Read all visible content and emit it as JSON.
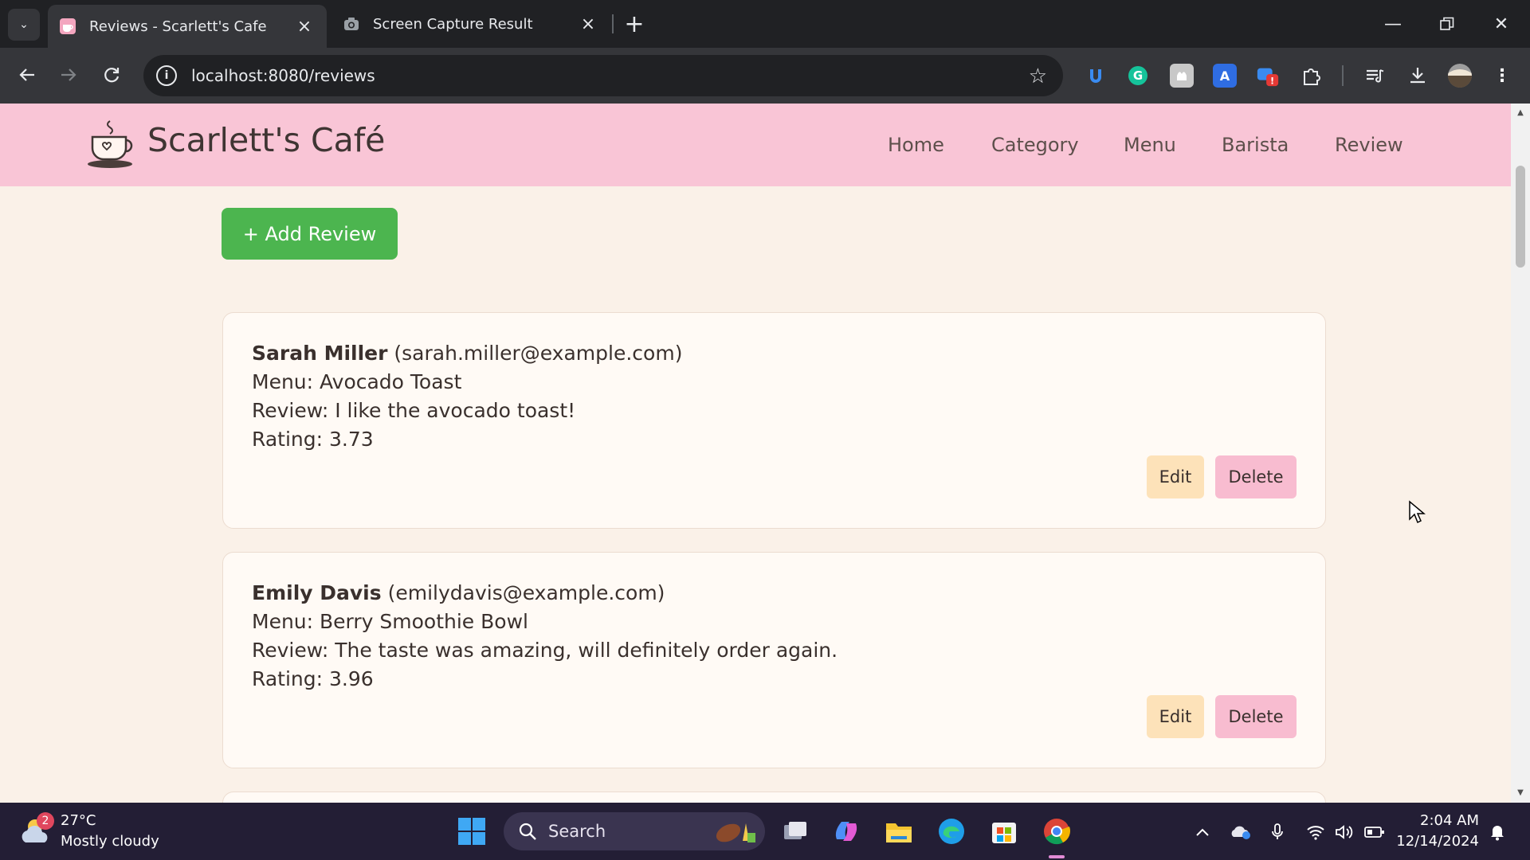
{
  "browser": {
    "tabs": [
      {
        "title": "Reviews - Scarlett's Cafe",
        "favicon": "cafe-favicon",
        "active": true
      },
      {
        "title": "Screen Capture Result",
        "favicon": "camera-icon",
        "active": false
      }
    ],
    "address": "localhost:8080/reviews",
    "extensions": [
      "blue-extension-icon",
      "grammarly-icon",
      "gray-extension-icon",
      "translate-extension-icon",
      "red-badge-extension-icon",
      "puzzle-icon"
    ],
    "toolbar_icons": [
      "reading-list-icon",
      "download-icon",
      "profile-avatar"
    ]
  },
  "site": {
    "brand": "Scarlett's Café",
    "nav": [
      "Home",
      "Category",
      "Menu",
      "Barista",
      "Review"
    ],
    "add_button": "+ Add Review",
    "colors": {
      "header": "#f9c5d6",
      "add_button": "#4cb54f",
      "edit": "#fde2b9",
      "delete": "#f8bcd0",
      "background": "#faf1e8"
    }
  },
  "reviews": [
    {
      "name": "Sarah Miller",
      "email": "(sarah.miller@example.com)",
      "menu": "Menu: Avocado Toast",
      "review": "Review: I like the avocado toast!",
      "rating": "Rating: 3.73",
      "edit_label": "Edit",
      "delete_label": "Delete"
    },
    {
      "name": "Emily Davis",
      "email": "(emilydavis@example.com)",
      "menu": "Menu: Berry Smoothie Bowl",
      "review": "Review: The taste was amazing, will definitely order again.",
      "rating": "Rating: 3.96",
      "edit_label": "Edit",
      "delete_label": "Delete"
    }
  ],
  "taskbar": {
    "weather": {
      "temp": "27°C",
      "desc": "Mostly cloudy",
      "badge": "2"
    },
    "search_label": "Search",
    "apps": [
      "task-view-icon",
      "copilot-icon",
      "file-explorer-icon",
      "edge-icon",
      "store-icon",
      "chrome-icon"
    ],
    "time": "2:04 AM",
    "date": "12/14/2024"
  }
}
